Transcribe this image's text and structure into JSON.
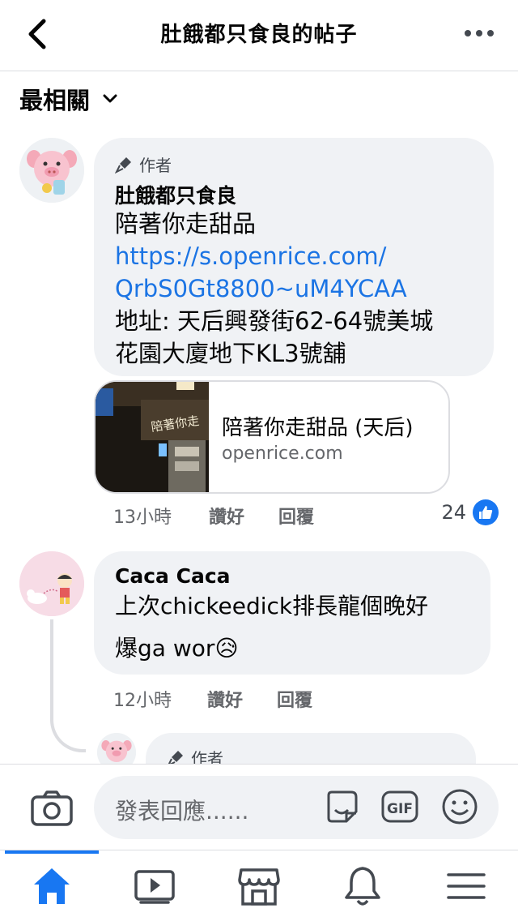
{
  "header": {
    "title": "肚餓都只食良的帖子",
    "back_icon": "chevron-left-icon",
    "more_icon": "ellipsis-icon"
  },
  "sort": {
    "label": "最相關",
    "icon": "chevron-down-icon"
  },
  "comments": [
    {
      "author_badge": "作者",
      "name": "肚餓都只食良",
      "text_line1": "陪著你走甜品",
      "link_line1": "https://s.openrice.com/",
      "link_line2": "QrbS0Gt8800~uM4YCAA",
      "text_line2": "地址: 天后興發街62-64號美城",
      "text_line3": "花園大廈地下KL3號舖",
      "link_preview": {
        "thumb_text": "陪著你走",
        "title": "陪著你走甜品 (天后)",
        "domain": "openrice.com"
      },
      "time": "13小時",
      "like_label": "讚好",
      "reply_label": "回覆",
      "reaction_count": "24"
    },
    {
      "name": "Caca Caca",
      "text_line1": "上次chickeedick排長龍個晚好",
      "text_line2": "爆ga wor😥",
      "time": "12小時",
      "like_label": "讚好",
      "reply_label": "回覆"
    },
    {
      "author_badge": "作者"
    }
  ],
  "composer": {
    "placeholder": "發表回應......",
    "icons": [
      "camera-icon",
      "sticker-icon",
      "gif-icon",
      "emoji-icon"
    ],
    "gif_label": "GIF"
  },
  "tabbar": {
    "tabs": [
      "home-icon",
      "video-icon",
      "marketplace-icon",
      "bell-icon",
      "menu-icon"
    ],
    "active": "home-icon",
    "active_color": "#1877f2"
  },
  "colors": {
    "link": "#1b74e4",
    "bubble": "#f0f2f5",
    "meta": "#65676b",
    "accent": "#1877f2"
  }
}
